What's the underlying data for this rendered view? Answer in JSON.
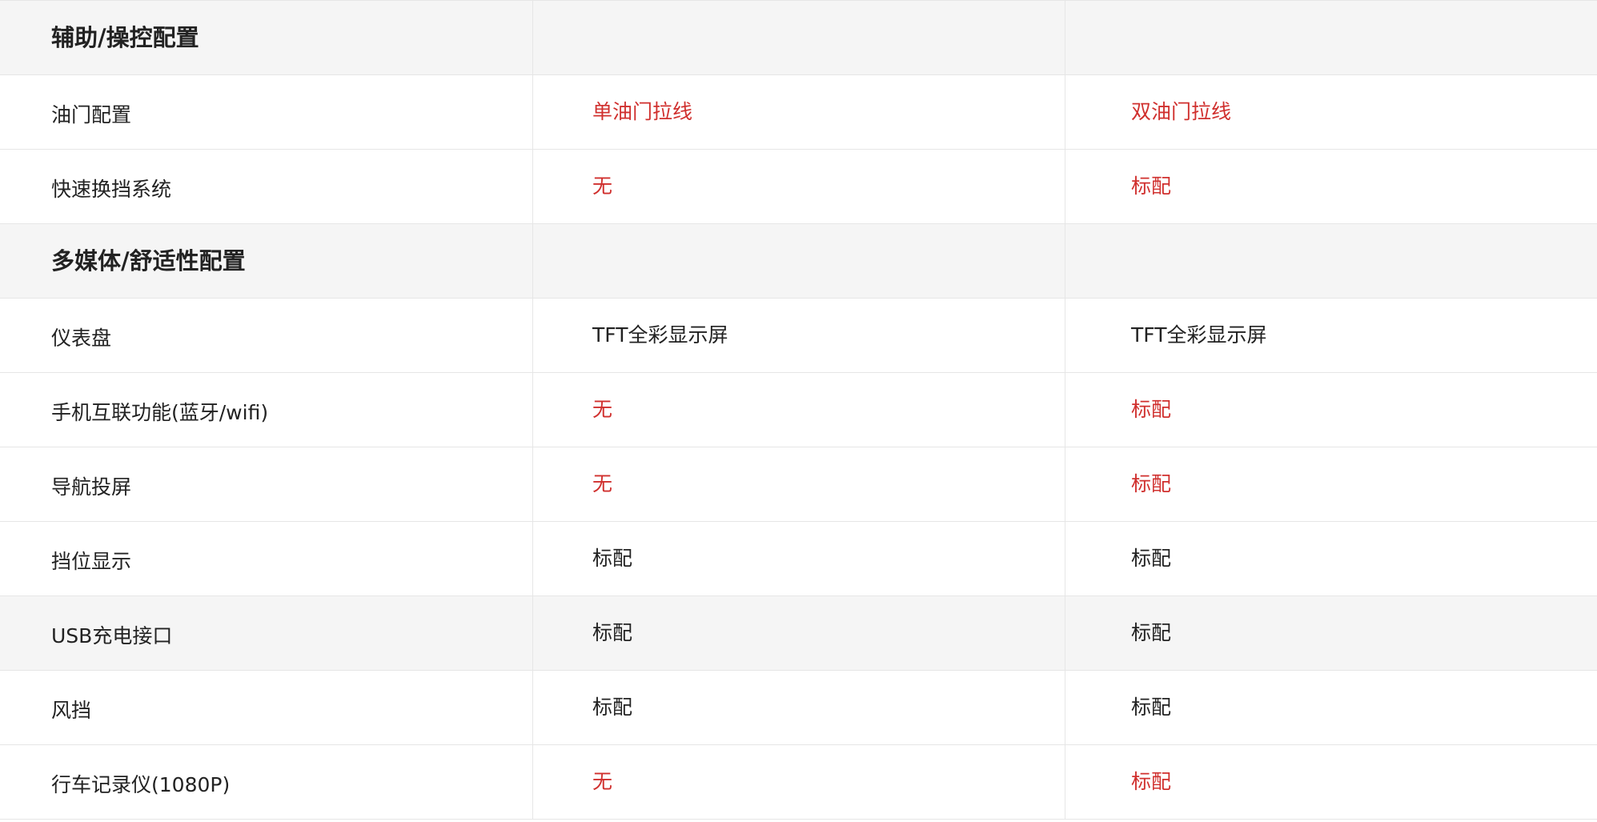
{
  "colors": {
    "accent_red": "#d0302e",
    "text": "#222222",
    "section_bg": "#f5f5f5",
    "border": "#e6e6e6"
  },
  "rows": [
    {
      "kind": "section",
      "label": "辅助/操控配置",
      "a": "",
      "b": ""
    },
    {
      "kind": "item",
      "label": "油门配置",
      "a": "单油门拉线",
      "b": "双油门拉线",
      "a_color": "red",
      "b_color": "red"
    },
    {
      "kind": "item",
      "label": "快速换挡系统",
      "a": "无",
      "b": "标配",
      "a_color": "red",
      "b_color": "red"
    },
    {
      "kind": "section",
      "label": "多媒体/舒适性配置",
      "a": "",
      "b": ""
    },
    {
      "kind": "item",
      "label": "仪表盘",
      "a": "TFT全彩显示屏",
      "b": "TFT全彩显示屏",
      "a_color": "dark",
      "b_color": "dark"
    },
    {
      "kind": "item",
      "label": "手机互联功能(蓝牙/wifi)",
      "a": "无",
      "b": "标配",
      "a_color": "red",
      "b_color": "red"
    },
    {
      "kind": "item",
      "label": "导航投屏",
      "a": "无",
      "b": "标配",
      "a_color": "red",
      "b_color": "red"
    },
    {
      "kind": "item",
      "label": "挡位显示",
      "a": "标配",
      "b": "标配",
      "a_color": "dark",
      "b_color": "dark"
    },
    {
      "kind": "item",
      "label": "USB充电接口",
      "a": "标配",
      "b": "标配",
      "a_color": "dark",
      "b_color": "dark",
      "shaded": true
    },
    {
      "kind": "item",
      "label": "风挡",
      "a": "标配",
      "b": "标配",
      "a_color": "dark",
      "b_color": "dark"
    },
    {
      "kind": "item",
      "label": "行车记录仪(1080P)",
      "a": "无",
      "b": "标配",
      "a_color": "red",
      "b_color": "red"
    }
  ]
}
